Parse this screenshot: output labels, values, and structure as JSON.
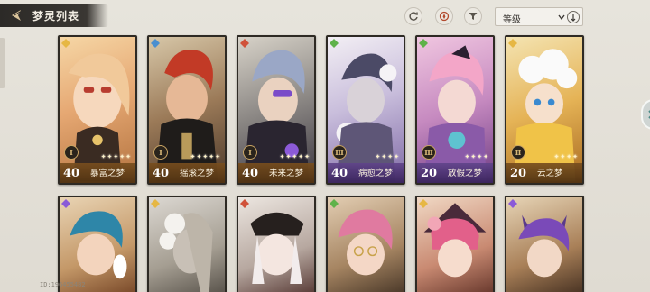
{
  "header": {
    "title": "梦灵列表",
    "back_icon": "back-arrow-icon"
  },
  "toolbar": {
    "refresh_icon": "refresh-icon",
    "element_filter_icon": "element-filter-icon",
    "filter_icon": "funnel-filter-icon",
    "sort": {
      "selected": "等级",
      "direction_icon": "sort-direction-icon"
    }
  },
  "cards_row1": [
    {
      "level": "40",
      "name": "暴富之梦",
      "stars": "✦✦✦✦✦",
      "element": "yellow",
      "frame": "gold"
    },
    {
      "level": "40",
      "name": "摇滚之梦",
      "stars": "✦✦✦✦✦",
      "element": "blue",
      "frame": "gold"
    },
    {
      "level": "40",
      "name": "未来之梦",
      "stars": "✦✦✦✦✦",
      "element": "red",
      "frame": "gold"
    },
    {
      "level": "40",
      "name": "病愈之梦",
      "stars": "✦✦✦✦",
      "element": "green",
      "frame": "purple"
    },
    {
      "level": "20",
      "name": "放假之梦",
      "stars": "✦✦✦✦",
      "element": "green",
      "frame": "purple"
    },
    {
      "level": "20",
      "name": "云之梦",
      "stars": "✦✦✦✦",
      "element": "yellow",
      "frame": "gold"
    }
  ],
  "cards_row2": [
    {
      "element": "purple"
    },
    {
      "element": "yellow"
    },
    {
      "element": "red"
    },
    {
      "element": "green"
    },
    {
      "element": "yellow"
    },
    {
      "element": "purple"
    }
  ],
  "footer": {
    "uid": "ID:196455482"
  },
  "colors": {
    "gold_band": "#7a4e1e",
    "purple_band": "#5a3a8a",
    "accent": "#c9a464"
  }
}
